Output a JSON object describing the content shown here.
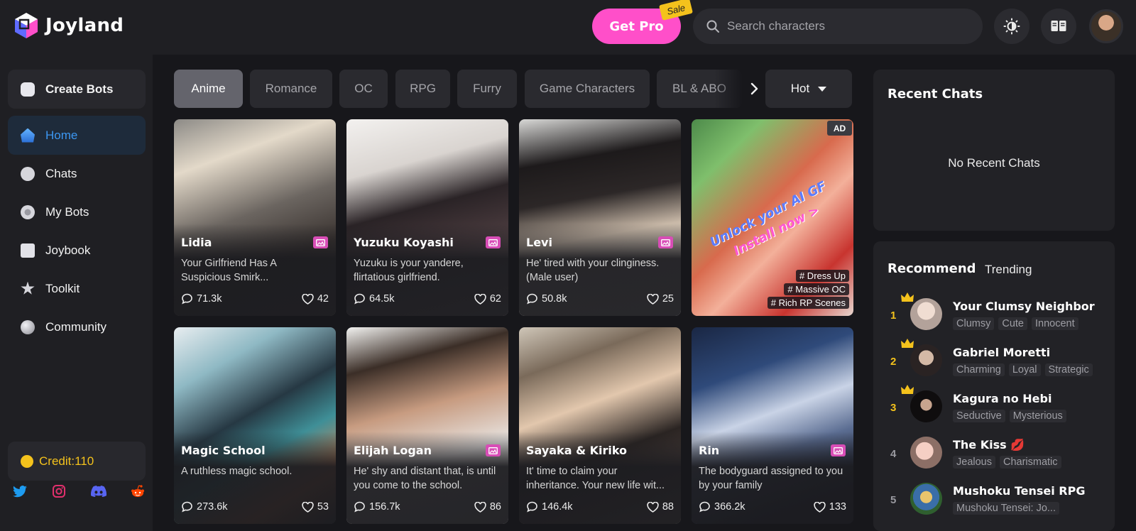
{
  "brand": {
    "name": "Joyland"
  },
  "header": {
    "get_pro_label": "Get Pro",
    "sale_label": "Sale",
    "search_placeholder": "Search characters",
    "icons": [
      "theme-toggle-icon",
      "book-icon",
      "user-avatar"
    ]
  },
  "sidebar": {
    "create_label": "Create Bots",
    "items": [
      {
        "label": "Home",
        "icon": "home-icon",
        "active": true
      },
      {
        "label": "Chats",
        "icon": "chat-icon"
      },
      {
        "label": "My Bots",
        "icon": "bot-icon"
      },
      {
        "label": "Joybook",
        "icon": "book-icon"
      },
      {
        "label": "Toolkit",
        "icon": "star-icon"
      },
      {
        "label": "Community",
        "icon": "globe-icon"
      }
    ],
    "credit_label": "Credit:110",
    "socials": [
      "twitter-icon",
      "instagram-icon",
      "discord-icon",
      "reddit-icon"
    ]
  },
  "categories": {
    "tabs": [
      "Anime",
      "Romance",
      "OC",
      "RPG",
      "Furry",
      "Game Characters",
      "BL & ABO"
    ],
    "active": "Anime",
    "sort_label": "Hot"
  },
  "cards": [
    {
      "name": "Lidia",
      "desc": "Your Girlfriend Has A Suspicious Smirk...",
      "chats": "71.3k",
      "likes": "42",
      "badge": true
    },
    {
      "name": "Yuzuku Koyashi",
      "desc": "Yuzuku is your yandere, flirtatious girlfriend.",
      "chats": "64.5k",
      "likes": "62",
      "badge": true
    },
    {
      "name": "Levi",
      "desc": "He' tired with your clinginess. (Male user)",
      "chats": "50.8k",
      "likes": "25",
      "badge": true
    },
    {
      "name": "Magic School",
      "desc": "A ruthless magic school.",
      "chats": "273.6k",
      "likes": "53",
      "badge": false
    },
    {
      "name": "Elijah Logan",
      "desc": "He' shy and distant that, is until you come to the school.",
      "chats": "156.7k",
      "likes": "86",
      "badge": true
    },
    {
      "name": "Sayaka & Kiriko",
      "desc": "It' time to claim your inheritance. Your new life wit...",
      "chats": "146.4k",
      "likes": "88",
      "badge": false
    },
    {
      "name": "Rin",
      "desc": "The bodyguard assigned to you by your family",
      "chats": "366.2k",
      "likes": "133",
      "badge": true
    }
  ],
  "ad": {
    "badge": "AD",
    "line1": "Unlock your AI GF",
    "line2": "Install now >",
    "features": [
      "# Dress Up",
      "# Massive OC",
      "# Rich RP Scenes"
    ]
  },
  "recent": {
    "title": "Recent Chats",
    "empty": "No Recent Chats"
  },
  "recommend": {
    "tab_active": "Recommend",
    "tab_other": "Trending",
    "items": [
      {
        "rank": "1",
        "name": "Your Clumsy Neighbor",
        "tags": [
          "Clumsy",
          "Cute",
          "Innocent"
        ]
      },
      {
        "rank": "2",
        "name": "Gabriel Moretti",
        "tags": [
          "Charming",
          "Loyal",
          "Strategic"
        ]
      },
      {
        "rank": "3",
        "name": "Kagura no Hebi",
        "tags": [
          "Seductive",
          "Mysterious"
        ]
      },
      {
        "rank": "4",
        "name": "The Kiss 💋",
        "tags": [
          "Jealous",
          "Charismatic"
        ]
      },
      {
        "rank": "5",
        "name": "Mushoku Tensei RPG",
        "tags": [
          "Mushoku Tensei: Jo..."
        ]
      }
    ]
  },
  "colors": {
    "accent_pink": "#ff4fc9",
    "active_blue": "#3c97f2",
    "gold": "#f4c21c"
  }
}
